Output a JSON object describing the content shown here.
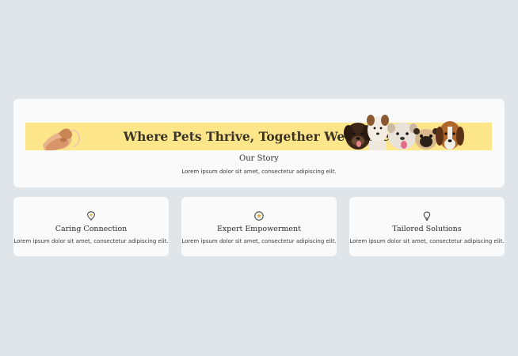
{
  "hero": {
    "banner_title": "Where Pets Thrive, Together We Strive.",
    "title": "Our Story",
    "description": "Lorem ipsum dolor sit amet, consectetur adipiscing elit.",
    "banner_color": "#fde68a"
  },
  "features": [
    {
      "icon": "heart-pin-icon",
      "title": "Caring Connection",
      "description": "Lorem ipsum dolor sit amet, consectetur adipiscing elit."
    },
    {
      "icon": "star-badge-icon",
      "title": "Expert Empowerment",
      "description": "Lorem ipsum dolor sit amet, consectetur adipiscing elit."
    },
    {
      "icon": "lightbulb-icon",
      "title": "Tailored Solutions",
      "description": "Lorem ipsum dolor sit amet, consectetur adipiscing elit."
    }
  ],
  "colors": {
    "page_background": "#e0e5e9",
    "card_background": "#fafafa",
    "text": "#2c2c2c"
  }
}
